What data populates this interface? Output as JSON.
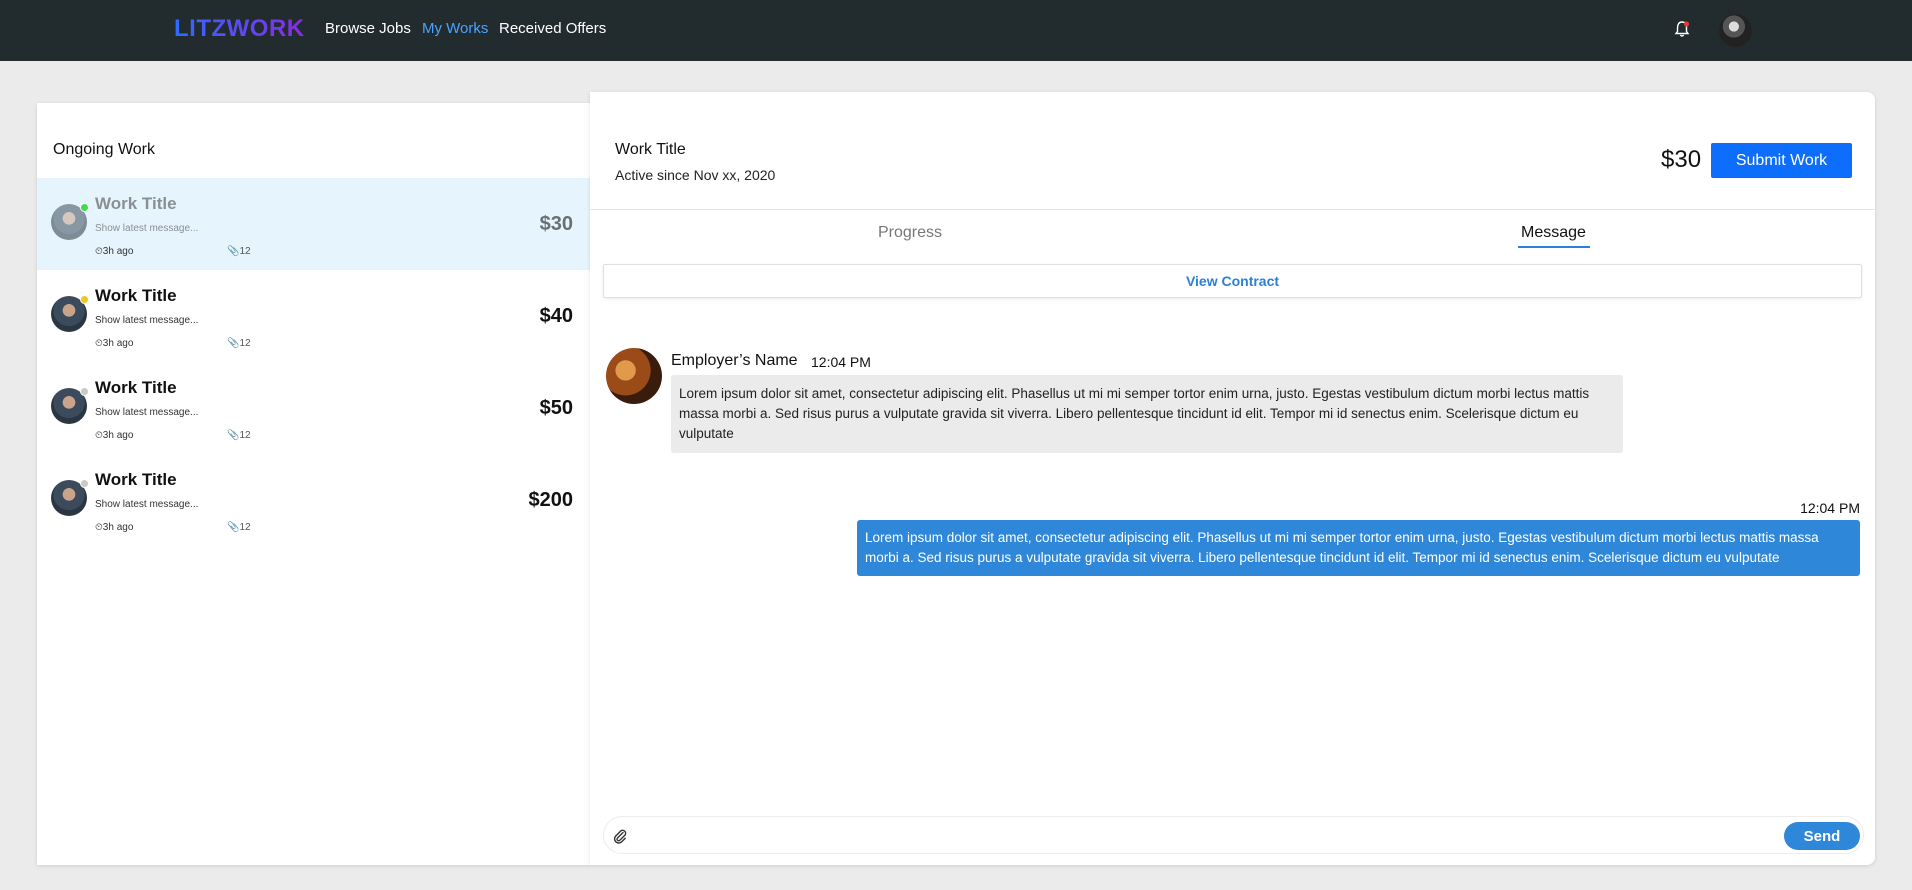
{
  "nav": {
    "logo": "LITZWORK",
    "links": [
      {
        "label": "Browse Jobs",
        "active": false
      },
      {
        "label": "My Works",
        "active": true
      },
      {
        "label": "Received Offers",
        "active": false
      }
    ],
    "accent_color": "#4aa3ff"
  },
  "sidebar": {
    "title": "Ongoing Work",
    "items": [
      {
        "title": "Work Title",
        "message": "Show latest message...",
        "time": "⏲3h ago",
        "attachments": "📎12",
        "price": "$30",
        "status_color": "#3ddc4a",
        "selected": true
      },
      {
        "title": "Work Title",
        "message": "Show latest message...",
        "time": "⏲3h ago",
        "attachments": "📎12",
        "price": "$40",
        "status_color": "#f5c518",
        "selected": false
      },
      {
        "title": "Work Title",
        "message": "Show latest message...",
        "time": "⏲3h ago",
        "attachments": "📎12",
        "price": "$50",
        "status_color": "#c9c9c9",
        "selected": false
      },
      {
        "title": "Work Title",
        "message": "Show latest message...",
        "time": "⏲3h ago",
        "attachments": "📎12",
        "price": "$200",
        "status_color": "#c9c9c9",
        "selected": false
      }
    ]
  },
  "detail": {
    "title": "Work Title",
    "subtitle": "Active since Nov xx, 2020",
    "price": "$30",
    "submit_label": "Submit Work",
    "tabs": [
      {
        "label": "Progress",
        "active": false
      },
      {
        "label": "Message",
        "active": true
      }
    ],
    "contract_label": "View Contract"
  },
  "chat": {
    "incoming": {
      "sender": "Employer’s Name",
      "time": "12:04 PM",
      "text": "Lorem ipsum dolor sit amet, consectetur adipiscing elit. Phasellus ut mi mi semper tortor enim urna, justo. Egestas vestibulum dictum morbi lectus mattis massa morbi a. Sed risus purus a vulputate gravida sit viverra. Libero pellentesque tincidunt id elit. Tempor mi id senectus enim. Scelerisque dictum eu vulputate"
    },
    "outgoing": {
      "time": "12:04 PM",
      "text": "Lorem ipsum dolor sit amet, consectetur adipiscing elit. Phasellus ut mi mi semper tortor enim urna, justo. Egestas vestibulum dictum morbi lectus mattis massa morbi a. Sed risus purus a vulputate gravida sit viverra. Libero pellentesque tincidunt id elit. Tempor mi id senectus enim. Scelerisque dictum eu vulputate"
    },
    "composer": {
      "placeholder": "",
      "send_label": "Send"
    }
  }
}
